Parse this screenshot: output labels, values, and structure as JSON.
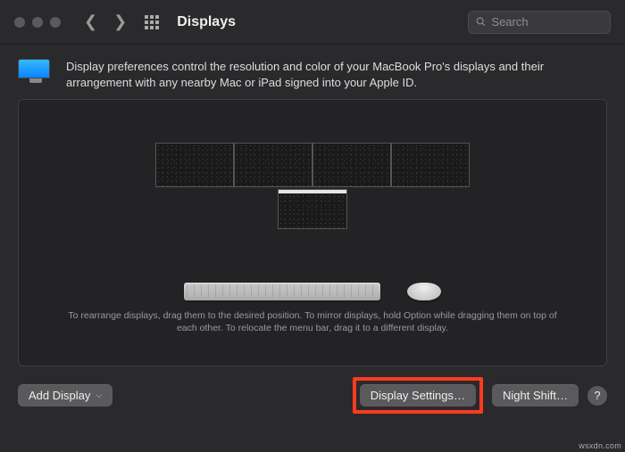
{
  "toolbar": {
    "title": "Displays",
    "search_placeholder": "Search"
  },
  "description": "Display preferences control the resolution and color of your MacBook Pro's displays and their arrangement with any nearby Mac or iPad signed into your Apple ID.",
  "hint": "To rearrange displays, drag them to the desired position. To mirror displays, hold Option while dragging them on top of each other. To relocate the menu bar, drag it to a different display.",
  "buttons": {
    "add_display": "Add Display",
    "display_settings": "Display Settings…",
    "night_shift": "Night Shift…",
    "help": "?"
  },
  "watermark": "wsxdn.com"
}
